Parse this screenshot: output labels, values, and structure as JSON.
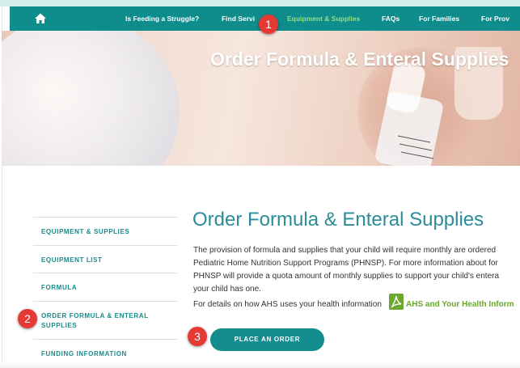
{
  "nav": {
    "items": [
      {
        "label": "Is Feeding a Struggle?",
        "active": false
      },
      {
        "label": "Find Servi",
        "active": false
      },
      {
        "label": "Equipment & Supplies",
        "active": true
      },
      {
        "label": "FAQs",
        "active": false
      },
      {
        "label": "For Families",
        "active": false
      },
      {
        "label": "For Prov",
        "active": false
      }
    ]
  },
  "hero": {
    "title": "Order Formula & Enteral Supplies"
  },
  "sidebar": {
    "items": [
      {
        "label": "EQUIPMENT & SUPPLIES"
      },
      {
        "label": "EQUIPMENT LIST"
      },
      {
        "label": "FORMULA"
      },
      {
        "label": "ORDER FORMULA & ENTERAL",
        "label2": "SUPPLIES"
      },
      {
        "label": "FUNDING INFORMATION"
      }
    ]
  },
  "main": {
    "title": "Order Formula & Enteral Supplies",
    "paragraph_lines": [
      "The provision of formula and supplies that your child will require monthly are ordered",
      "Pediatric Home Nutrition Support Programs (PHNSP). For more information about for",
      "PHNSP will provide a quota amount of monthly supplies to support your child's entera",
      "your child has one."
    ],
    "details_text": "For details on how AHS uses your health information",
    "details_link": "AHS and Your Health Inform",
    "order_button": "PLACE AN ORDER"
  },
  "badges": [
    "1",
    "2",
    "3"
  ],
  "colors": {
    "teal": "#0f8c8c",
    "active_nav": "#8fe089",
    "link_green": "#6aa82e",
    "badge_red": "#e53935"
  }
}
